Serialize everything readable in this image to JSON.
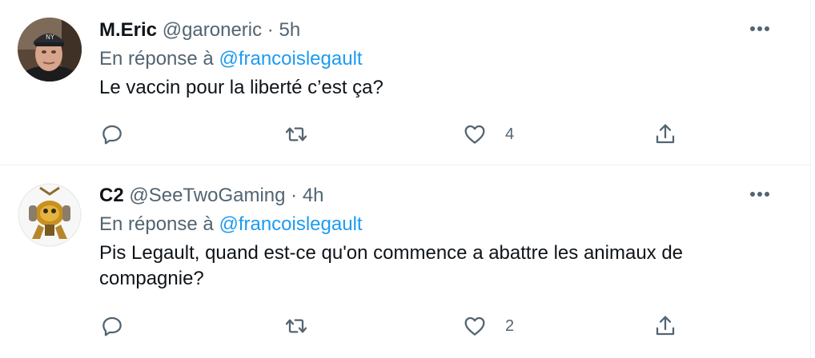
{
  "tweets": [
    {
      "name": "M.Eric",
      "handle": "@garoneric",
      "separator": "·",
      "time": "5h",
      "reply_prefix": "En réponse à",
      "reply_mention": "@francoislegault",
      "text": "Le vaccin pour la liberté c’est ça?",
      "likes": "4",
      "avatar_icon": "profile-photo-man-cap"
    },
    {
      "name": "C2",
      "handle": "@SeeTwoGaming",
      "separator": "·",
      "time": "4h",
      "reply_prefix": "En réponse à",
      "reply_mention": "@francoislegault",
      "text": "Pis Legault, quand est-ce qu'on commence a abattre les animaux de compagnie?",
      "likes": "2",
      "avatar_icon": "robot-character"
    }
  ],
  "icons": {
    "more": "more-horizontal-icon",
    "reply": "reply-icon",
    "retweet": "retweet-icon",
    "like": "heart-icon",
    "share": "share-icon"
  },
  "colors": {
    "text_primary": "#0f1419",
    "text_secondary": "#536471",
    "link": "#1d9bf0",
    "divider": "#eff3f4"
  }
}
